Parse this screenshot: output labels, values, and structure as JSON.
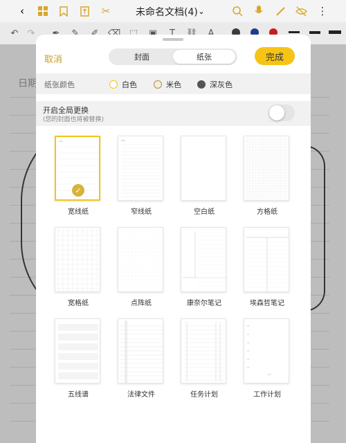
{
  "app": {
    "title": "未命名文档(4)",
    "bg_date_label": "日期"
  },
  "icons": [
    "back-icon",
    "grid-icon",
    "bookmark-icon",
    "export-icon",
    "scissors-icon",
    "chevron-down-icon",
    "search-icon",
    "mic-icon",
    "pen-icon",
    "eye-off-icon",
    "more-icon"
  ],
  "pen_colors": [
    "#3b3b3b",
    "#1f3d8c",
    "#c51f1f"
  ],
  "sheet": {
    "cancel_label": "取消",
    "done_label": "完成",
    "tabs": [
      {
        "label": "封面",
        "active": false
      },
      {
        "label": "纸张",
        "active": true
      }
    ],
    "paper_color": {
      "label": "纸张颜色",
      "options": [
        {
          "label": "白色",
          "color": "#ffffff",
          "selected": true
        },
        {
          "label": "米色",
          "color": "#f5eedc",
          "selected": false
        },
        {
          "label": "深灰色",
          "color": "#555555",
          "selected": false
        }
      ]
    },
    "global_toggle": {
      "title": "开启全局更换",
      "subtitle": "(您的封面也将被替换)",
      "on": false
    },
    "templates": [
      {
        "label": "宽线纸",
        "selected": true
      },
      {
        "label": "窄线纸",
        "selected": false
      },
      {
        "label": "空白纸",
        "selected": false
      },
      {
        "label": "方格纸",
        "selected": false
      },
      {
        "label": "宽格纸",
        "selected": false
      },
      {
        "label": "点阵纸",
        "selected": false
      },
      {
        "label": "康奈尔笔记",
        "selected": false
      },
      {
        "label": "埃森哲笔记",
        "selected": false
      },
      {
        "label": "五线谱",
        "selected": false
      },
      {
        "label": "法律文件",
        "selected": false
      },
      {
        "label": "任务计划",
        "selected": false
      },
      {
        "label": "工作计划",
        "selected": false
      }
    ],
    "accent_color": "#f6c416"
  }
}
